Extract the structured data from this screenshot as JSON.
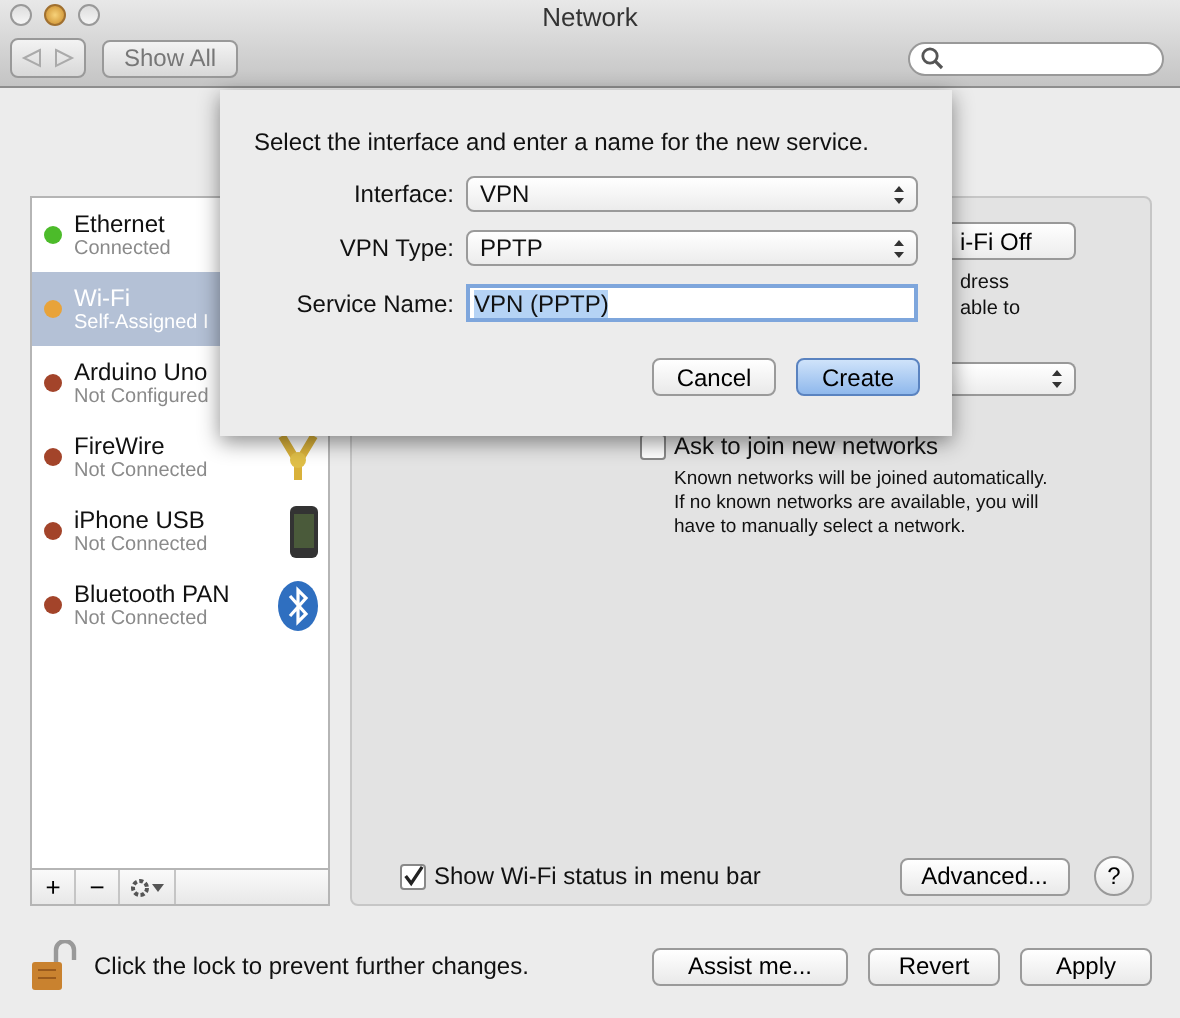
{
  "window": {
    "title": "Network"
  },
  "toolbar": {
    "show_all": "Show All"
  },
  "services": [
    {
      "name": "Ethernet",
      "status": "Connected",
      "color": "#4cbb2a",
      "selected": false
    },
    {
      "name": "Wi-Fi",
      "status": "Self-Assigned I",
      "color": "#e8a33a",
      "selected": true
    },
    {
      "name": "Arduino Uno",
      "status": "Not Configured",
      "color": "#a3442a",
      "selected": false
    },
    {
      "name": "FireWire",
      "status": "Not Connected",
      "color": "#a3442a",
      "selected": false,
      "kind": "firewire"
    },
    {
      "name": "iPhone USB",
      "status": "Not Connected",
      "color": "#a3442a",
      "selected": false,
      "kind": "phone"
    },
    {
      "name": "Bluetooth PAN",
      "status": "Not Connected",
      "color": "#a3442a",
      "selected": false,
      "kind": "bluetooth"
    }
  ],
  "list_buttons": [
    "+",
    "−"
  ],
  "detail": {
    "wifi_button": "i-Fi Off",
    "note_fragments": [
      "dress",
      "able to"
    ],
    "ask_join": {
      "label": "Ask to join new networks",
      "checked": false,
      "note": "Known networks will be joined automatically.\nIf no known networks are available, you will\nhave to manually select a network."
    },
    "show_status": {
      "label": "Show Wi-Fi status in menu bar",
      "checked": true
    },
    "advanced": "Advanced...",
    "help": "?"
  },
  "sheet": {
    "prompt": "Select the interface and enter a name for the new service.",
    "fields": [
      {
        "kind": "popup",
        "label": "Interface:",
        "value": "VPN"
      },
      {
        "kind": "popup",
        "label": "VPN Type:",
        "value": "PPTP"
      },
      {
        "kind": "text",
        "label": "Service Name:",
        "value": "VPN (PPTP)",
        "selected": true
      }
    ],
    "buttons": [
      {
        "label": "Cancel",
        "default": false
      },
      {
        "label": "Create",
        "default": true
      }
    ]
  },
  "lock": {
    "text": "Click the lock to prevent further changes."
  },
  "buttons": [
    "Assist me...",
    "Revert",
    "Apply"
  ]
}
